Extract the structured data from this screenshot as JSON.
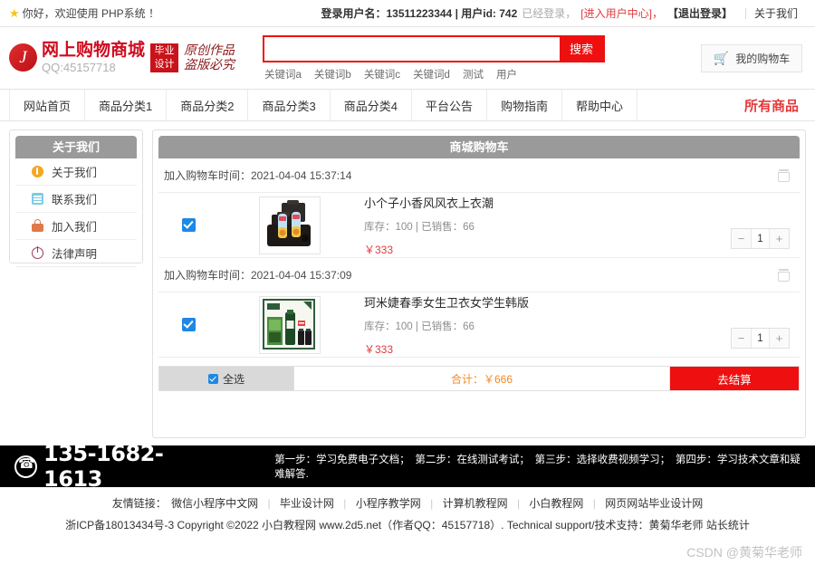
{
  "topbar": {
    "star_icon": "star-icon",
    "welcome": "你好，欢迎使用 PHP系统 ！",
    "login_label": "登录用户名：13511223344 | 用户id: 742",
    "status": "已经登录，",
    "user_center": "[进入用户中心]，",
    "logout": "【退出登录】",
    "about": "关于我们"
  },
  "header": {
    "logo_letter": "J",
    "logo_title": "网上购物商城",
    "logo_sub": "QQ:45157718",
    "badge_line1": "毕业",
    "badge_line2": "设计",
    "calli_line1": "原创作品",
    "calli_line2": "盗版必究",
    "search_value": "",
    "search_placeholder": "",
    "search_button": "搜索",
    "keywords": [
      "关键词a",
      "关键词b",
      "关键词c",
      "关键词d",
      "测试",
      "用户"
    ],
    "cart_icon": "shopping-cart-icon",
    "cart_label": "我的购物车"
  },
  "nav": {
    "items": [
      "网站首页",
      "商品分类1",
      "商品分类2",
      "商品分类3",
      "商品分类4",
      "平台公告",
      "购物指南",
      "帮助中心"
    ],
    "right_label": "所有商品"
  },
  "sidebar": {
    "header": "关于我们",
    "items": [
      {
        "label": "关于我们",
        "icon": "info-circle-icon"
      },
      {
        "label": "联系我们",
        "icon": "clipboard-icon"
      },
      {
        "label": "加入我们",
        "icon": "lock-icon"
      },
      {
        "label": "法律声明",
        "icon": "power-icon"
      }
    ]
  },
  "cart": {
    "panel_title": "商城购物车",
    "items": [
      {
        "time_label": "加入购物车时间：2021-04-04 15:37:14",
        "name": "小个子小香风风衣上衣潮",
        "stock": "库存：100 | 已销售：66",
        "price": "￥333",
        "qty": "1",
        "minus": "−",
        "plus": "+",
        "checked": true,
        "thumb_alt": "product-image-bottles",
        "trash_icon": "trash-icon"
      },
      {
        "time_label": "加入购物车时间：2021-04-04 15:37:09",
        "name": "珂米婕春季女生卫衣女学生韩版",
        "stock": "库存：100 | 已销售：66",
        "price": "￥333",
        "qty": "1",
        "minus": "−",
        "plus": "+",
        "checked": true,
        "thumb_alt": "product-image-cosmetics-set",
        "trash_icon": "trash-icon"
      }
    ],
    "select_all": "全选",
    "total": "合计：￥666",
    "checkout": "去结算"
  },
  "footer": {
    "phone_icon": "phone-icon",
    "phone": "135-1682-1613",
    "steps": "第一步：学习免费电子文档；　第二步：在线测试考试；　第三步：选择收费视频学习；　第四步：学习技术文章和疑难解答.",
    "links_label": "友情链接：",
    "links": [
      "微信小程序中文网",
      "毕业设计网",
      "小程序教学网",
      "计算机教程网",
      "小白教程网",
      "网页网站毕业设计网"
    ],
    "copyright": "浙ICP备18013434号-3 Copyright ©2022 小白教程网 www.2d5.net（作者QQ：45157718）. Technical support/技术支持：黄菊华老师 站长统计",
    "watermark": "CSDN @黄菊华老师"
  },
  "colors": {
    "brand_red": "#ee1010",
    "logo_red": "#d00b1e",
    "accent_orange": "#f08a24",
    "panel_gray": "#9a9a9a",
    "checkbox_blue": "#1e88e5"
  }
}
